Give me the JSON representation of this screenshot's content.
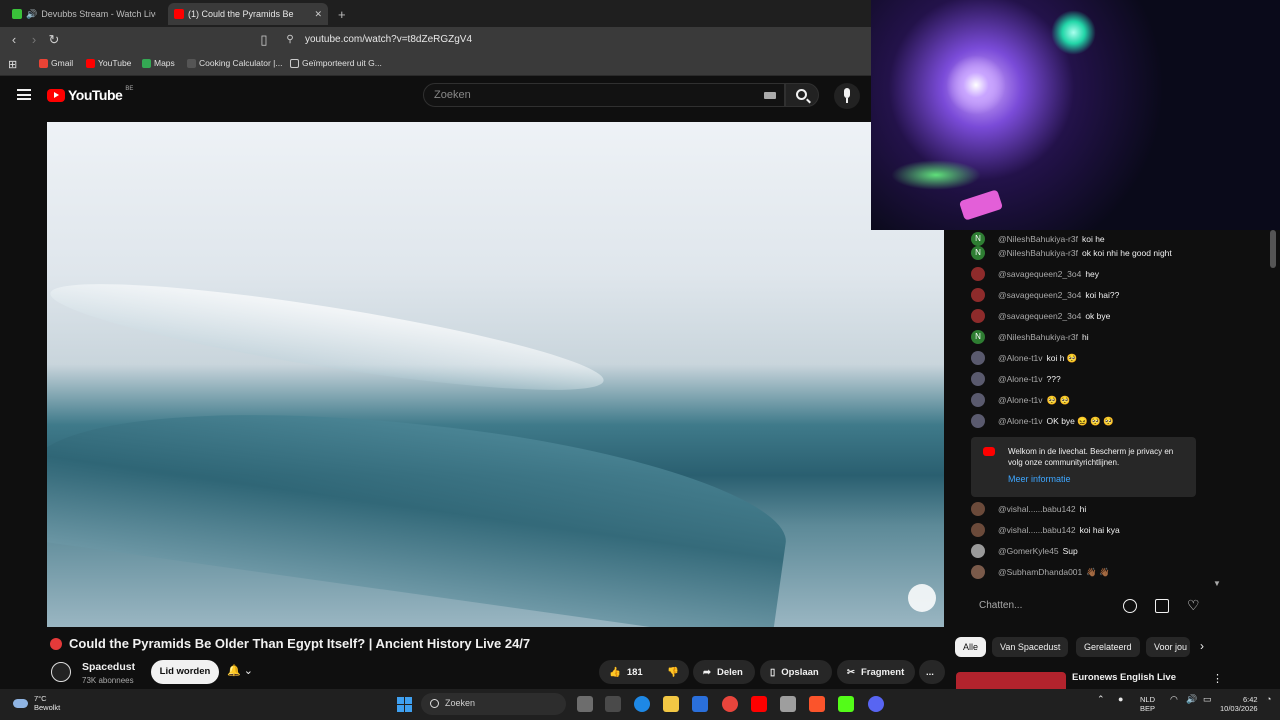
{
  "browser": {
    "tabs": [
      {
        "label": "Devubbs Stream - Watch Live on",
        "active": false
      },
      {
        "label": "(1)  Could the Pyramids Be",
        "active": true
      }
    ],
    "new_tab_symbol": "+",
    "url": "youtube.com/watch?v=t8dZeRGZgV4",
    "bookmarks": [
      "Gmail",
      "YouTube",
      "Maps",
      "Cooking Calculator |...",
      "Geïmporteerd uit G..."
    ]
  },
  "youtube": {
    "logo_text": "YouTube",
    "country_code": "BE",
    "search_placeholder": "Zoeken"
  },
  "video": {
    "title": "Could the Pyramids Be Older Than Egypt Itself? | Ancient History Live 24/7",
    "channel": "Spacedust",
    "subscribers": "73K abonnees",
    "join_label": "Lid worden",
    "likes": "181",
    "share_label": "Delen",
    "save_label": "Opslaan",
    "clip_label": "Fragment",
    "more_symbol": "..."
  },
  "chat": {
    "messages": [
      {
        "author": "@NileshBahukiya-r3f",
        "text": "koi he",
        "avatar": "N",
        "color": "#2e7d32"
      },
      {
        "author": "@NileshBahukiya-r3f",
        "text": "ok koi nhi he good night",
        "avatar": "N",
        "color": "#2e7d32"
      },
      {
        "author": "@savagequeen2_3o4",
        "text": "hey",
        "avatar": "",
        "color": "#8e2b2b"
      },
      {
        "author": "@savagequeen2_3o4",
        "text": "koi hai??",
        "avatar": "",
        "color": "#8e2b2b"
      },
      {
        "author": "@savagequeen2_3o4",
        "text": "ok bye",
        "avatar": "",
        "color": "#8e2b2b"
      },
      {
        "author": "@NileshBahukiya-r3f",
        "text": "hi",
        "avatar": "N",
        "color": "#2e7d32"
      },
      {
        "author": "@Alone-t1v",
        "text": "koi h 🥺",
        "avatar": "",
        "color": "#5a5a6e"
      },
      {
        "author": "@Alone-t1v",
        "text": "???",
        "avatar": "",
        "color": "#5a5a6e"
      },
      {
        "author": "@Alone-t1v",
        "text": "🥺 🥺",
        "avatar": "",
        "color": "#5a5a6e"
      },
      {
        "author": "@Alone-t1v",
        "text": "OK bye 😖 🥺 🥺",
        "avatar": "",
        "color": "#5a5a6e"
      },
      {
        "author": "@vishal......babu142",
        "text": "hi",
        "avatar": "",
        "color": "#6b4a3a"
      },
      {
        "author": "@vishal......babu142",
        "text": "koi hai kya",
        "avatar": "",
        "color": "#6b4a3a"
      },
      {
        "author": "@GomerKyle45",
        "text": "Sup",
        "avatar": "",
        "color": "#9a9a9a"
      },
      {
        "author": "@SubhamDhanda001",
        "text": "👋🏾 👋🏾",
        "avatar": "",
        "color": "#7a5a4a"
      }
    ],
    "notice_text": "Welkom in de livechat. Bescherm je privacy en volg onze communityrichtlijnen.",
    "notice_link": "Meer informatie",
    "input_placeholder": "Chatten..."
  },
  "chips": [
    "Alle",
    "Van Spacedust",
    "Gerelateerd",
    "Voor jou"
  ],
  "recommended_title": "Euronews English Live",
  "taskbar": {
    "weather_temp": "7°C",
    "weather_text": "Bewolkt",
    "search_label": "Zoeken",
    "lang_top": "NLD",
    "lang_bottom": "BEP",
    "time": "6:42",
    "date": "10/03/2026"
  }
}
